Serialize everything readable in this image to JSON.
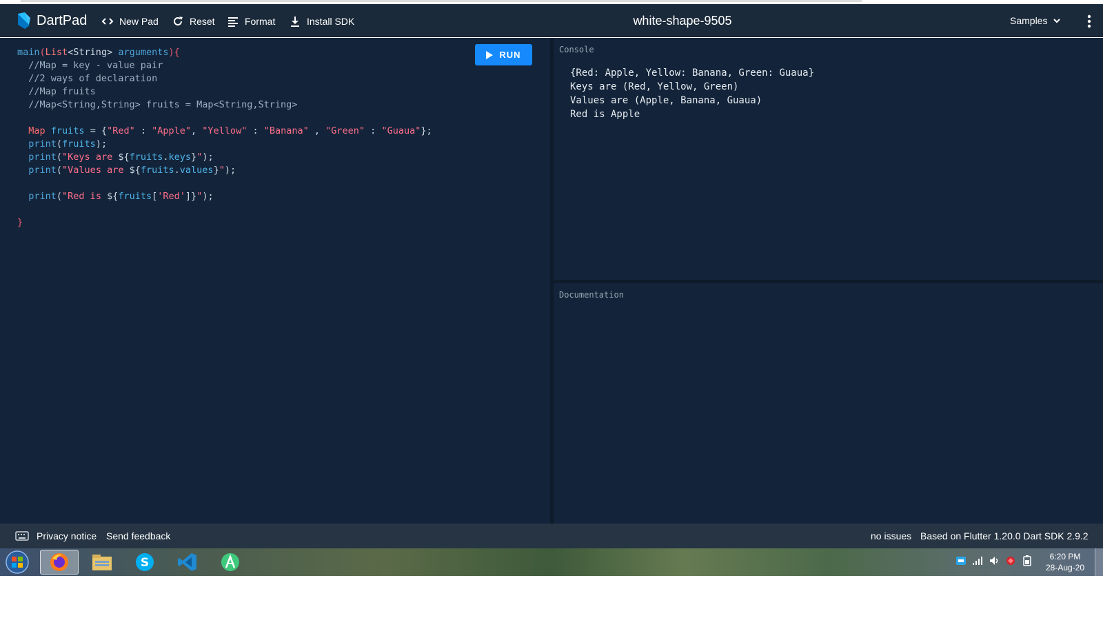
{
  "app": {
    "brand": "DartPad",
    "pad_name": "white-shape-9505"
  },
  "toolbar": {
    "new_pad": "New Pad",
    "reset": "Reset",
    "format": "Format",
    "install_sdk": "Install SDK",
    "samples": "Samples"
  },
  "editor": {
    "run_label": "RUN",
    "lines": [
      [
        [
          "main",
          "fn"
        ],
        [
          "(",
          "par"
        ],
        [
          "List",
          "type"
        ],
        [
          "<String> ",
          "pun"
        ],
        [
          "arguments",
          "fn"
        ],
        [
          "){",
          "par"
        ]
      ],
      [
        [
          "  //Map = key - value pair",
          "cm"
        ]
      ],
      [
        [
          "  //2 ways of declaration",
          "cm"
        ]
      ],
      [
        [
          "  //Map fruits",
          "cm"
        ]
      ],
      [
        [
          "  //Map<String,String> fruits = Map<String,String>",
          "cm"
        ]
      ],
      [],
      [
        [
          "  ",
          "pun"
        ],
        [
          "Map",
          "kw"
        ],
        [
          " ",
          "pun"
        ],
        [
          "fruits",
          "var"
        ],
        [
          " = {",
          "pun"
        ],
        [
          "\"Red\"",
          "str"
        ],
        [
          " : ",
          "pun"
        ],
        [
          "\"Apple\"",
          "str"
        ],
        [
          ", ",
          "pun"
        ],
        [
          "\"Yellow\"",
          "str"
        ],
        [
          " : ",
          "pun"
        ],
        [
          "\"Banana\"",
          "str"
        ],
        [
          " , ",
          "pun"
        ],
        [
          "\"Green\"",
          "str"
        ],
        [
          " : ",
          "pun"
        ],
        [
          "\"Guaua\"",
          "str"
        ],
        [
          "};",
          "pun"
        ]
      ],
      [
        [
          "  ",
          "pun"
        ],
        [
          "print",
          "fn"
        ],
        [
          "(",
          "pun"
        ],
        [
          "fruits",
          "var"
        ],
        [
          ");",
          "pun"
        ]
      ],
      [
        [
          "  ",
          "pun"
        ],
        [
          "print",
          "fn"
        ],
        [
          "(",
          "pun"
        ],
        [
          "\"Keys are ",
          "str"
        ],
        [
          "${",
          "pun"
        ],
        [
          "fruits",
          "var"
        ],
        [
          ".",
          "pun"
        ],
        [
          "keys",
          "var"
        ],
        [
          "}",
          "pun"
        ],
        [
          "\"",
          "str"
        ],
        [
          ");",
          "pun"
        ]
      ],
      [
        [
          "  ",
          "pun"
        ],
        [
          "print",
          "fn"
        ],
        [
          "(",
          "pun"
        ],
        [
          "\"Values are ",
          "str"
        ],
        [
          "${",
          "pun"
        ],
        [
          "fruits",
          "var"
        ],
        [
          ".",
          "pun"
        ],
        [
          "values",
          "var"
        ],
        [
          "}",
          "pun"
        ],
        [
          "\"",
          "str"
        ],
        [
          ");",
          "pun"
        ]
      ],
      [],
      [
        [
          "  ",
          "pun"
        ],
        [
          "print",
          "fn"
        ],
        [
          "(",
          "pun"
        ],
        [
          "\"Red is ",
          "str"
        ],
        [
          "${",
          "pun"
        ],
        [
          "fruits",
          "var"
        ],
        [
          "[",
          "pun"
        ],
        [
          "'Red'",
          "str"
        ],
        [
          "]}",
          "pun"
        ],
        [
          "\"",
          "str"
        ],
        [
          ");",
          "pun"
        ]
      ],
      [],
      [
        [
          "}",
          "par"
        ]
      ]
    ]
  },
  "console": {
    "label": "Console",
    "output": "{Red: Apple, Yellow: Banana, Green: Guaua}\nKeys are (Red, Yellow, Green)\nValues are (Apple, Banana, Guaua)\nRed is Apple"
  },
  "documentation": {
    "label": "Documentation"
  },
  "footer": {
    "privacy": "Privacy notice",
    "feedback": "Send feedback",
    "issues": "no issues",
    "sdk_info": "Based on Flutter 1.20.0 Dart SDK 2.9.2"
  },
  "taskbar": {
    "time": "6:20 PM",
    "date": "28-Aug-20",
    "apps": [
      "start-orb-icon",
      "firefox-icon",
      "file-explorer-icon",
      "skype-icon",
      "vscode-icon",
      "android-studio-icon"
    ]
  },
  "colors": {
    "header_bg": "#1b2a3a",
    "editor_bg": "#13243a",
    "run_button": "#168afd",
    "footer_bg": "#263443"
  }
}
